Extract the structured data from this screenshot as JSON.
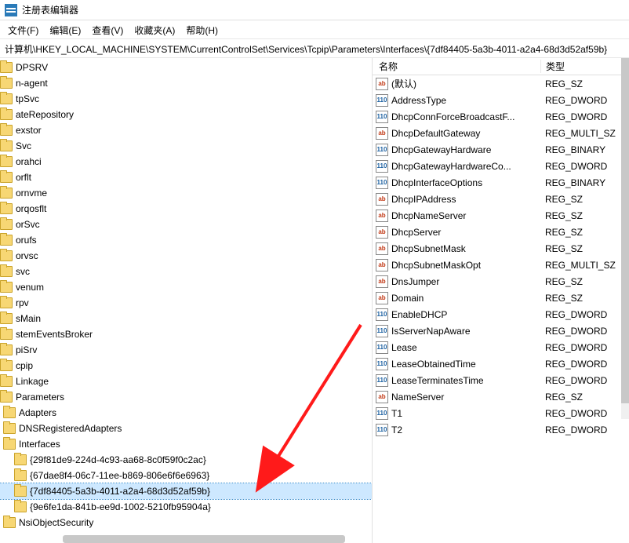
{
  "window": {
    "title": "注册表编辑器"
  },
  "menu": {
    "file": "文件(F)",
    "edit": "编辑(E)",
    "view": "查看(V)",
    "favorites": "收藏夹(A)",
    "help": "帮助(H)"
  },
  "address": "计算机\\HKEY_LOCAL_MACHINE\\SYSTEM\\CurrentControlSet\\Services\\Tcpip\\Parameters\\Interfaces\\{7df84405-5a3b-4011-a2a4-68d3d52af59b}",
  "columns": {
    "name": "名称",
    "type": "类型"
  },
  "values": [
    {
      "name": "(默认)",
      "type": "REG_SZ",
      "icon": "sz"
    },
    {
      "name": "AddressType",
      "type": "REG_DWORD",
      "icon": "dw"
    },
    {
      "name": "DhcpConnForceBroadcastF...",
      "type": "REG_DWORD",
      "icon": "dw"
    },
    {
      "name": "DhcpDefaultGateway",
      "type": "REG_MULTI_SZ",
      "icon": "sz"
    },
    {
      "name": "DhcpGatewayHardware",
      "type": "REG_BINARY",
      "icon": "dw"
    },
    {
      "name": "DhcpGatewayHardwareCo...",
      "type": "REG_DWORD",
      "icon": "dw"
    },
    {
      "name": "DhcpInterfaceOptions",
      "type": "REG_BINARY",
      "icon": "dw"
    },
    {
      "name": "DhcpIPAddress",
      "type": "REG_SZ",
      "icon": "sz"
    },
    {
      "name": "DhcpNameServer",
      "type": "REG_SZ",
      "icon": "sz"
    },
    {
      "name": "DhcpServer",
      "type": "REG_SZ",
      "icon": "sz"
    },
    {
      "name": "DhcpSubnetMask",
      "type": "REG_SZ",
      "icon": "sz"
    },
    {
      "name": "DhcpSubnetMaskOpt",
      "type": "REG_MULTI_SZ",
      "icon": "sz"
    },
    {
      "name": "DnsJumper",
      "type": "REG_SZ",
      "icon": "sz"
    },
    {
      "name": "Domain",
      "type": "REG_SZ",
      "icon": "sz"
    },
    {
      "name": "EnableDHCP",
      "type": "REG_DWORD",
      "icon": "dw"
    },
    {
      "name": "IsServerNapAware",
      "type": "REG_DWORD",
      "icon": "dw"
    },
    {
      "name": "Lease",
      "type": "REG_DWORD",
      "icon": "dw"
    },
    {
      "name": "LeaseObtainedTime",
      "type": "REG_DWORD",
      "icon": "dw"
    },
    {
      "name": "LeaseTerminatesTime",
      "type": "REG_DWORD",
      "icon": "dw"
    },
    {
      "name": "NameServer",
      "type": "REG_SZ",
      "icon": "sz"
    },
    {
      "name": "T1",
      "type": "REG_DWORD",
      "icon": "dw"
    },
    {
      "name": "T2",
      "type": "REG_DWORD",
      "icon": "dw"
    }
  ],
  "tree_top": [
    "DPSRV",
    "n-agent",
    "tpSvc",
    "ateRepository",
    "exstor",
    "Svc",
    "orahci",
    "orflt",
    "ornvme",
    "orqosflt",
    "orSvc",
    "orufs",
    "orvsc",
    "svc",
    "venum",
    "rpv",
    "sMain",
    "stemEventsBroker",
    "piSrv",
    "cpip"
  ],
  "tree_tcpip": {
    "linkage": "Linkage",
    "parameters": "Parameters",
    "adapters": "Adapters",
    "dnsreg": "DNSRegisteredAdapters",
    "interfaces": "Interfaces",
    "guids": [
      "{29f81de9-224d-4c93-aa68-8c0f59f0c2ac}",
      "{67dae8f4-06c7-11ee-b869-806e6f6e6963}",
      "{7df84405-5a3b-4011-a2a4-68d3d52af59b}",
      "{9e6fe1da-841b-ee9d-1002-5210fb95904a}"
    ],
    "nsi": "NsiObjectSecurity"
  },
  "icon_text": {
    "sz": "ab",
    "dw": "110"
  }
}
